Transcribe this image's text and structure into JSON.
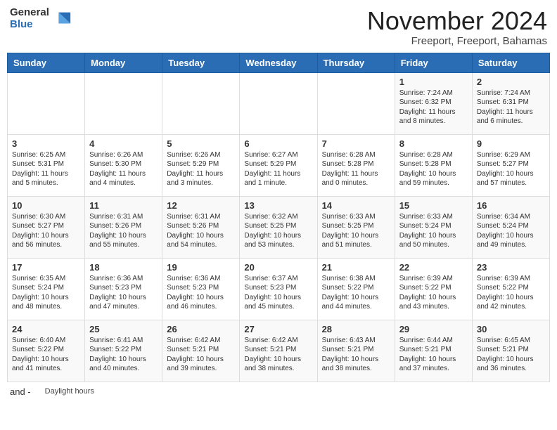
{
  "header": {
    "logo_line1": "General",
    "logo_line2": "Blue",
    "month": "November 2024",
    "location": "Freeport, Freeport, Bahamas"
  },
  "weekdays": [
    "Sunday",
    "Monday",
    "Tuesday",
    "Wednesday",
    "Thursday",
    "Friday",
    "Saturday"
  ],
  "weeks": [
    [
      {
        "day": "",
        "info": ""
      },
      {
        "day": "",
        "info": ""
      },
      {
        "day": "",
        "info": ""
      },
      {
        "day": "",
        "info": ""
      },
      {
        "day": "",
        "info": ""
      },
      {
        "day": "1",
        "info": "Sunrise: 7:24 AM\nSunset: 6:32 PM\nDaylight: 11 hours and 8 minutes."
      },
      {
        "day": "2",
        "info": "Sunrise: 7:24 AM\nSunset: 6:31 PM\nDaylight: 11 hours and 6 minutes."
      }
    ],
    [
      {
        "day": "3",
        "info": "Sunrise: 6:25 AM\nSunset: 5:31 PM\nDaylight: 11 hours and 5 minutes."
      },
      {
        "day": "4",
        "info": "Sunrise: 6:26 AM\nSunset: 5:30 PM\nDaylight: 11 hours and 4 minutes."
      },
      {
        "day": "5",
        "info": "Sunrise: 6:26 AM\nSunset: 5:29 PM\nDaylight: 11 hours and 3 minutes."
      },
      {
        "day": "6",
        "info": "Sunrise: 6:27 AM\nSunset: 5:29 PM\nDaylight: 11 hours and 1 minute."
      },
      {
        "day": "7",
        "info": "Sunrise: 6:28 AM\nSunset: 5:28 PM\nDaylight: 11 hours and 0 minutes."
      },
      {
        "day": "8",
        "info": "Sunrise: 6:28 AM\nSunset: 5:28 PM\nDaylight: 10 hours and 59 minutes."
      },
      {
        "day": "9",
        "info": "Sunrise: 6:29 AM\nSunset: 5:27 PM\nDaylight: 10 hours and 57 minutes."
      }
    ],
    [
      {
        "day": "10",
        "info": "Sunrise: 6:30 AM\nSunset: 5:27 PM\nDaylight: 10 hours and 56 minutes."
      },
      {
        "day": "11",
        "info": "Sunrise: 6:31 AM\nSunset: 5:26 PM\nDaylight: 10 hours and 55 minutes."
      },
      {
        "day": "12",
        "info": "Sunrise: 6:31 AM\nSunset: 5:26 PM\nDaylight: 10 hours and 54 minutes."
      },
      {
        "day": "13",
        "info": "Sunrise: 6:32 AM\nSunset: 5:25 PM\nDaylight: 10 hours and 53 minutes."
      },
      {
        "day": "14",
        "info": "Sunrise: 6:33 AM\nSunset: 5:25 PM\nDaylight: 10 hours and 51 minutes."
      },
      {
        "day": "15",
        "info": "Sunrise: 6:33 AM\nSunset: 5:24 PM\nDaylight: 10 hours and 50 minutes."
      },
      {
        "day": "16",
        "info": "Sunrise: 6:34 AM\nSunset: 5:24 PM\nDaylight: 10 hours and 49 minutes."
      }
    ],
    [
      {
        "day": "17",
        "info": "Sunrise: 6:35 AM\nSunset: 5:24 PM\nDaylight: 10 hours and 48 minutes."
      },
      {
        "day": "18",
        "info": "Sunrise: 6:36 AM\nSunset: 5:23 PM\nDaylight: 10 hours and 47 minutes."
      },
      {
        "day": "19",
        "info": "Sunrise: 6:36 AM\nSunset: 5:23 PM\nDaylight: 10 hours and 46 minutes."
      },
      {
        "day": "20",
        "info": "Sunrise: 6:37 AM\nSunset: 5:23 PM\nDaylight: 10 hours and 45 minutes."
      },
      {
        "day": "21",
        "info": "Sunrise: 6:38 AM\nSunset: 5:22 PM\nDaylight: 10 hours and 44 minutes."
      },
      {
        "day": "22",
        "info": "Sunrise: 6:39 AM\nSunset: 5:22 PM\nDaylight: 10 hours and 43 minutes."
      },
      {
        "day": "23",
        "info": "Sunrise: 6:39 AM\nSunset: 5:22 PM\nDaylight: 10 hours and 42 minutes."
      }
    ],
    [
      {
        "day": "24",
        "info": "Sunrise: 6:40 AM\nSunset: 5:22 PM\nDaylight: 10 hours and 41 minutes."
      },
      {
        "day": "25",
        "info": "Sunrise: 6:41 AM\nSunset: 5:22 PM\nDaylight: 10 hours and 40 minutes."
      },
      {
        "day": "26",
        "info": "Sunrise: 6:42 AM\nSunset: 5:21 PM\nDaylight: 10 hours and 39 minutes."
      },
      {
        "day": "27",
        "info": "Sunrise: 6:42 AM\nSunset: 5:21 PM\nDaylight: 10 hours and 38 minutes."
      },
      {
        "day": "28",
        "info": "Sunrise: 6:43 AM\nSunset: 5:21 PM\nDaylight: 10 hours and 38 minutes."
      },
      {
        "day": "29",
        "info": "Sunrise: 6:44 AM\nSunset: 5:21 PM\nDaylight: 10 hours and 37 minutes."
      },
      {
        "day": "30",
        "info": "Sunrise: 6:45 AM\nSunset: 5:21 PM\nDaylight: 10 hours and 36 minutes."
      }
    ]
  ],
  "legend": {
    "and_dash": "and -",
    "daylight_hours": "Daylight hours"
  }
}
